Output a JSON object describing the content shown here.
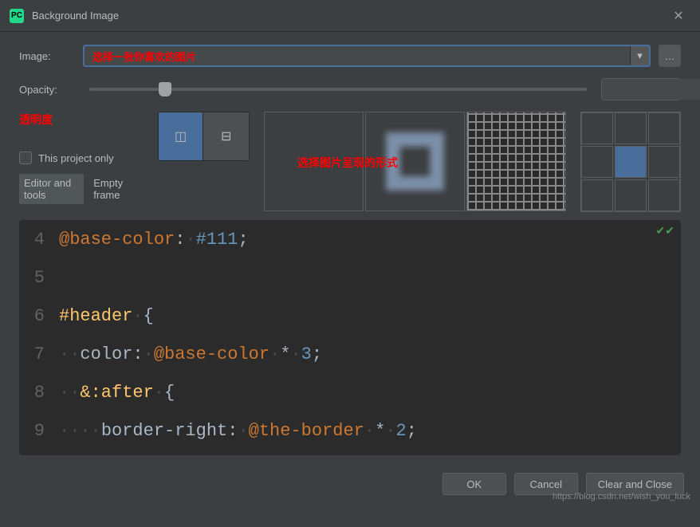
{
  "window": {
    "title": "Background Image"
  },
  "form": {
    "image_label": "Image:",
    "image_placeholder": "选择一张你喜欢的图片",
    "opacity_label": "Opacity:",
    "opacity_value": "15",
    "transparency_note": "透明度",
    "display_mode_note": "选择图片呈现的形式",
    "project_only_label": "This project only",
    "tabs": {
      "editor": "Editor and tools",
      "empty": "Empty frame"
    }
  },
  "code": {
    "lines": [
      {
        "n": "4",
        "raw_var": "@base-color",
        "raw_after": ":",
        "ws1": "·",
        "val": "#111",
        "end": ";"
      },
      {
        "n": "5",
        "blank": true
      },
      {
        "n": "6",
        "sel": "#header",
        "ws1": "·",
        "brace": "{"
      },
      {
        "n": "7",
        "ws_pre": "··",
        "prop": "color:",
        "ws1": "·",
        "var": "@base-color",
        "ws2": "·",
        "op": "*",
        "ws3": "·",
        "num": "3",
        "end": ";"
      },
      {
        "n": "8",
        "ws_pre": "··",
        "sel": "&:after",
        "ws1": "·",
        "brace": "{"
      },
      {
        "n": "9",
        "ws_pre": "····",
        "prop": "border-right:",
        "ws1": "·",
        "var": "@the-border",
        "ws2": "·",
        "op": "*",
        "ws3": "·",
        "num": "2",
        "end": ";"
      }
    ]
  },
  "buttons": {
    "ok": "OK",
    "cancel": "Cancel",
    "clear_close": "Clear and Close"
  },
  "watermark": "https://blog.csdn.net/wish_you_luck"
}
